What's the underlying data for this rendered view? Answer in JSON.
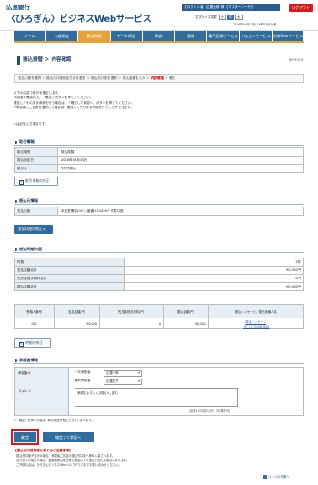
{
  "header": {
    "bank_name": "広島銀行",
    "service_name": "〈ひろぎん〉ビジネスWebサービス",
    "login_info": "【ログイン者】広銀太郎 様 【マスターユーザ】",
    "logout_label": "ログアウト",
    "font_size_label": "文字サイズ変更",
    "font_small": "小",
    "font_medium": "中",
    "font_large": "大",
    "datetime": "2016年09月27日 16時52分26秒"
  },
  "nav": {
    "items": [
      {
        "label": "ホーム",
        "active": false
      },
      {
        "label": "口座照会",
        "active": false
      },
      {
        "label": "資金移動",
        "active": true
      },
      {
        "label": "データ伝送",
        "active": false
      },
      {
        "label": "承認",
        "active": false
      },
      {
        "label": "管理",
        "active": false
      },
      {
        "label": "電子記録サービス",
        "active": false
      },
      {
        "label": "でんさいサービス",
        "active": false
      },
      {
        "label": "外為Webサービス",
        "active": false
      }
    ]
  },
  "page": {
    "title": "振込振替 ＞ 内容確認",
    "screen_id": "BFKF024",
    "steps": {
      "before": "支払口座を選択 ＞ 振込先口座指定方法を選択 ＞ 振込先口座を選択 ＞ 振込金額を入力 ＞ ",
      "current": "内容確認",
      "after": " ＞ 確定"
    },
    "intro_line1": "以下の内容で取引を確定します。",
    "intro_line2": "承認者を確認の上、「確定」ボタンを押してください。",
    "intro_line3": "確定してそのまま承認を行う場合は、「確定して承認へ」ボタンを押してください。",
    "intro_line4": "※承認者にご自身を選択した場合は、確定してそのまま承認を行うことができます。",
    "required_note": "は必須入力項目です。",
    "required_mark": "※"
  },
  "transaction": {
    "section_title": "取引情報",
    "rows": [
      {
        "label": "取引種別",
        "value": "振込振替"
      },
      {
        "label": "振込指定日",
        "value": "2016年09月30日"
      },
      {
        "label": "取引名",
        "value": "9月分振込"
      }
    ],
    "edit_button": "取引情報の修正"
  },
  "source_account": {
    "section_title": "振込元情報",
    "label": "支払口座",
    "value": "本店営業部(001) 普通 1234567 代表口座",
    "edit_button": "支払口座の修正"
  },
  "amounts": {
    "section_title": "振込明細内容",
    "rows": [
      {
        "label": "件数",
        "value": "1件"
      },
      {
        "label": "支払金額合計",
        "value": "90,000円"
      },
      {
        "label": "先方負担手数料合計",
        "value": "0円"
      },
      {
        "label": "振込金額合計",
        "value": "90,000円"
      }
    ]
  },
  "details": {
    "headers": [
      "受取人番号",
      "支払金額(円)",
      "先方負担手数料(円)",
      "振込金額(円)",
      "振込メッセージ／振込依頼人名"
    ],
    "rows": [
      {
        "no": "001",
        "pay": "90,000",
        "fee": "0",
        "amount": "90,000",
        "message": "振込メッセージ",
        "requester": "ﾋﾛｷﾞﾝ1234567890"
      }
    ],
    "edit_button": "明細の修正"
  },
  "approver": {
    "section_title": "承認者情報",
    "approver_label": "承認者",
    "first_label": "一次承認者",
    "first_value": "広銀一郎",
    "final_label": "最終承認者",
    "final_value": "広銀花子",
    "comment_label": "コメント",
    "comment_value": "承認をよろしくお願いします。",
    "comment_limit": "［全角120文字以内］［半角不可］"
  },
  "note": "※「確定」を押した後は、取引履歴を修正できなくなります。",
  "actions": {
    "confirm": "確 定",
    "confirm_approve": "確定して承認へ"
  },
  "caution": {
    "title": "【振込先口座情報に関するご注意事項】",
    "line1": "・振込先口座が当行の場合、承認後ご指定の振込先口座へ即時入金されます。",
    "line2": "・他行宛ての振込の場合、金融機関休業日等の理由により振込が遅れる場合があります。",
    "line3": "・ご不明な点は、ひろぎんビジネスWebヘルプデスクまでお問い合わせください。"
  },
  "pagetop": "ページの先頭へ"
}
